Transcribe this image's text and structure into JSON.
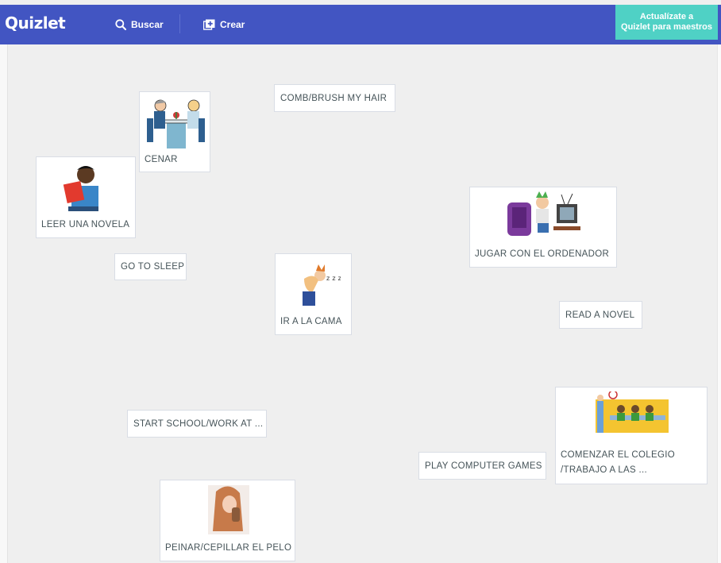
{
  "header": {
    "logo": "Quizlet",
    "search_label": "Buscar",
    "create_label": "Crear",
    "upgrade_line1": "Actualízate a",
    "upgrade_line2": "Quizlet para maestros"
  },
  "cards": {
    "comb_hair": "COMB/BRUSH MY HAIR",
    "cenar": "CENAR",
    "leer_novela": "LEER UNA NOVELA",
    "jugar_ordenador": "JUGAR CON EL ORDENADOR",
    "go_to_sleep": "GO TO SLEEP",
    "ir_cama": "IR A LA CAMA",
    "read_novel": "READ A NOVEL",
    "start_school": "START SCHOOL/WORK AT ...",
    "play_games": "PLAY COMPUTER GAMES",
    "comenzar_line1": "COMENZAR EL COLEGIO",
    "comenzar_line2": "/TRABAJO A LAS ...",
    "peinar": "PEINAR/CEPILLAR EL PELO"
  },
  "colors": {
    "header_bg": "#4255c2",
    "upgrade_bg": "#4fd1c5",
    "board_bg": "#efefef"
  },
  "icons": {
    "search": "search-icon",
    "create": "create-plus-icon"
  }
}
